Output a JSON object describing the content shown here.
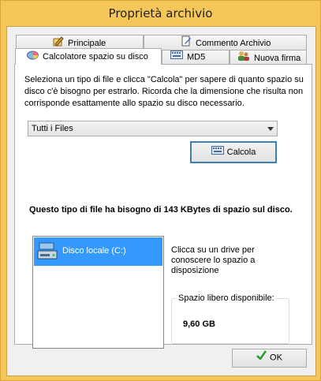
{
  "window": {
    "title": "Proprietà archivio"
  },
  "tabs": {
    "row1": [
      {
        "label": "Principale",
        "icon": "pencil-paper-icon"
      },
      {
        "label": "Commento Archivio",
        "icon": "edit-document-icon"
      }
    ],
    "row2": [
      {
        "label": "Calcolatore spazio su disco",
        "icon": "disk-pie-icon",
        "active": true
      },
      {
        "label": "MD5",
        "icon": "keyboard-icon"
      },
      {
        "label": "Nuova firma",
        "icon": "users-signature-icon"
      }
    ]
  },
  "calculator": {
    "description": "Seleziona un tipo di file e clicca \"Calcola\" per sapere di quanto spazio su disco c'è bisogno per estrarlo. Ricorda che la dimensione che risulta non corrisponde esattamente allo spazio su disco necessario.",
    "file_type_selected": "Tutti i Files",
    "calc_button": "Calcola",
    "result_text": "Questo tipo di file ha bisogno di 143 KBytes di spazio sul disco.",
    "drives": [
      {
        "label": "Disco locale (C:)",
        "selected": true
      }
    ],
    "drive_hint": "Clicca su un drive per conoscere lo spazio a disposizione",
    "free_space_label": "Spazio libero disponibile:",
    "free_space_value": "9,60 GB"
  },
  "footer": {
    "ok_button": "OK"
  },
  "colors": {
    "frame": "#f5c75a",
    "selection": "#3399ff",
    "accent_border": "#3c7fb1"
  }
}
